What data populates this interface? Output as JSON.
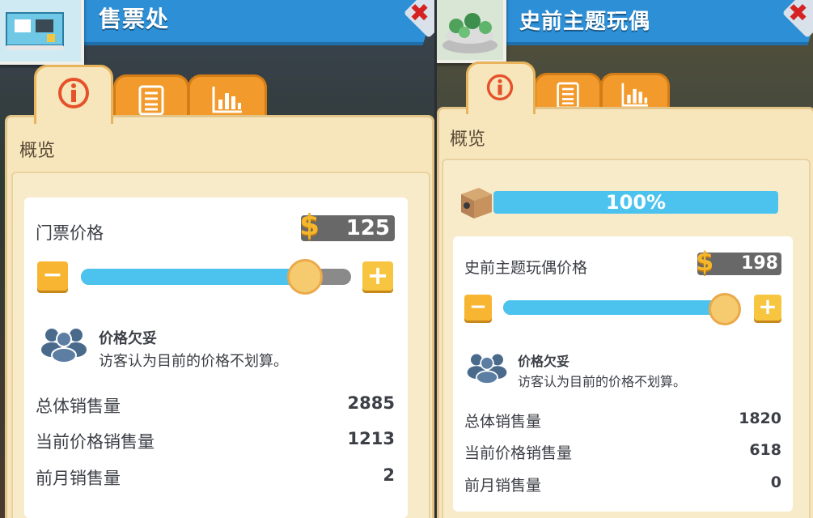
{
  "left_panel": {
    "title": "售票处",
    "close_symbol": "✖",
    "tabs": [
      {
        "icon": "info-icon",
        "active": true
      },
      {
        "icon": "list-icon",
        "active": false
      },
      {
        "icon": "bar-chart-icon",
        "active": false
      }
    ],
    "overview_label": "概览",
    "price": {
      "label": "门票价格",
      "value": "125",
      "currency": "$",
      "slider_level": 0.82
    },
    "minus_label": "−",
    "plus_label": "+",
    "feedback": {
      "title": "价格欠妥",
      "description": "访客认为目前的价格不划算。"
    },
    "stats": [
      {
        "label": "总体销售量",
        "value": "2885"
      },
      {
        "label": "当前价格销售量",
        "value": "1213"
      },
      {
        "label": "前月销售量",
        "value": "2"
      }
    ]
  },
  "right_panel": {
    "title": "史前主题玩偶",
    "close_symbol": "✖",
    "tabs": [
      {
        "icon": "info-icon",
        "active": true
      },
      {
        "icon": "list-icon",
        "active": false
      },
      {
        "icon": "bar-chart-icon",
        "active": false
      }
    ],
    "overview_label": "概览",
    "stock": {
      "percent_label": "100%",
      "level": 1.0
    },
    "price": {
      "label": "史前主题玩偶价格",
      "value": "198",
      "currency": "$",
      "slider_level": 1.0
    },
    "minus_label": "−",
    "plus_label": "+",
    "feedback": {
      "title": "价格欠妥",
      "description": "访客认为目前的价格不划算。"
    },
    "stats": [
      {
        "label": "总体销售量",
        "value": "1820"
      },
      {
        "label": "当前价格销售量",
        "value": "618"
      },
      {
        "label": "前月销售量",
        "value": "0"
      }
    ]
  },
  "colors": {
    "accent_blue": "#2d8fd6",
    "slider_fill": "#4cc3ee",
    "button_yellow": "#f7b531",
    "tab_orange": "#f39a2c"
  }
}
